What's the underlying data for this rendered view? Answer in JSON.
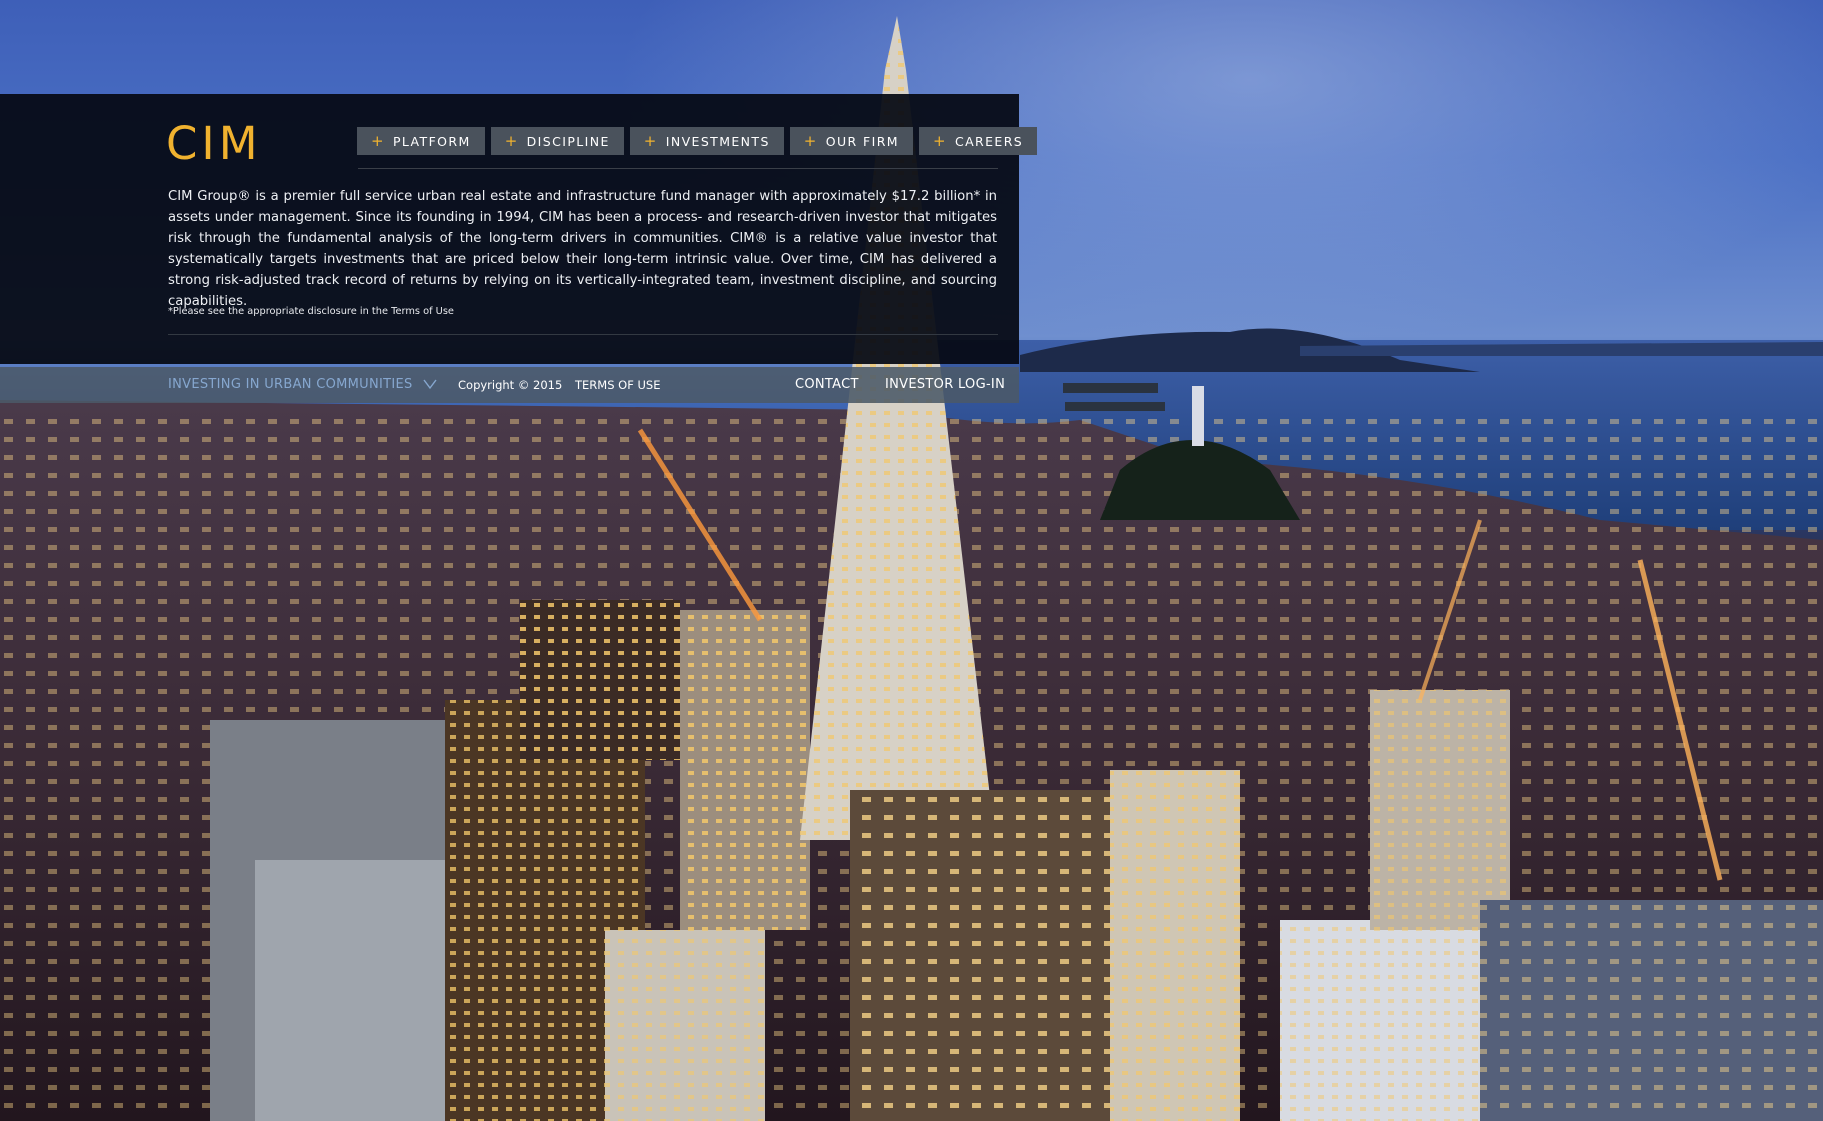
{
  "brand": {
    "logo_text": "CIM",
    "accent_color": "#f0b22f"
  },
  "nav": {
    "items": [
      {
        "label": "PLATFORM"
      },
      {
        "label": "DISCIPLINE"
      },
      {
        "label": "INVESTMENTS"
      },
      {
        "label": "OUR FIRM"
      },
      {
        "label": "CAREERS"
      }
    ],
    "bullet_icon": "plus-icon"
  },
  "about": {
    "text": "CIM Group® is a premier full service urban real estate and infrastructure fund manager with approximately $17.2 billion* in assets under management. Since its founding in 1994, CIM has been a process- and research-driven investor that mitigates risk through the fundamental analysis of the long-term drivers in communities. CIM® is a relative value investor that systematically targets investments that are priced below their long-term intrinsic value. Over time, CIM has delivered a strong risk-adjusted track record of returns by relying on its vertically-integrated team, investment discipline, and sourcing capabilities.",
    "disclaimer": "*Please see the appropriate disclosure in the Terms of Use"
  },
  "footer": {
    "tagline": "INVESTING IN URBAN COMMUNITIES",
    "tagline_icon": "chevron-down-icon",
    "copyright": "Copyright © 2015",
    "terms": "TERMS OF USE",
    "contact": "CONTACT",
    "investor_login": "INVESTOR LOG-IN"
  },
  "background": {
    "description_icon": "city-skyline-photo"
  }
}
